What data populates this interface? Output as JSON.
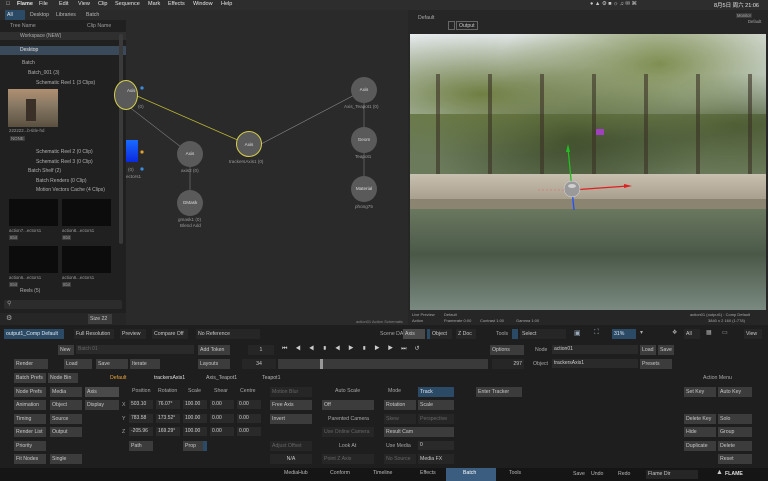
{
  "menubar": {
    "app": "Flame",
    "items": [
      "File",
      "Edit",
      "View",
      "Clip",
      "Sequence",
      "Mark",
      "Effects",
      "Window",
      "Help"
    ],
    "clock": "8月5日 周六 21:06"
  },
  "library": {
    "tabs": [
      "All",
      "Desktop",
      "Libraries",
      "Batch"
    ],
    "col_tree": "Tree Name",
    "col_clip": "Clip Name",
    "workspace": "Workspace (NEW)",
    "desktop": "Desktop",
    "batch": "Batch",
    "batch_001": "Batch_001 (3)",
    "schem1": "Schematic Reel 1 (3 Clips)",
    "clip_name": "222222...b-title-hd",
    "clip_badge": "NONE",
    "schem2": "Schematic Reel 2 (0 Clip)",
    "schem3": "Schematic Reel 3 (0 Clip)",
    "shelf": "Batch Shelf (2)",
    "renders": "Batch Renders (0 Clip)",
    "motion": "Motion Vectors Cache (4 Clips)",
    "thumbs": [
      {
        "name": "action7...ectors1",
        "badge": "8bit"
      },
      {
        "name": "action8...ectors1",
        "badge": "8bit"
      },
      {
        "name": "action6...ectors1",
        "badge": "8bit"
      },
      {
        "name": "action6...ectors1",
        "badge": "8bit"
      }
    ],
    "reels": "Reels (5)",
    "size": "Size 22"
  },
  "schematic": {
    "nodes": [
      {
        "name": "Axis",
        "label": "Axis_Teapot1 (0)"
      },
      {
        "name": "Geom",
        "label": "Teapot1"
      },
      {
        "name": "Material",
        "label": "phong75"
      },
      {
        "name": "Axis",
        "label": "trackersAxis1 (0)"
      },
      {
        "name": "Axis",
        "label": "axis2 (0)"
      },
      {
        "name": "GMask",
        "label": "gmask1 (0)"
      },
      {
        "name": "Axis",
        "label": "axis1 (0)"
      }
    ],
    "gmask_sub": "Blend Add",
    "partial_a": "(0)",
    "partial_b": "ectors1",
    "footer": "action01 Action Schematic"
  },
  "viewer": {
    "title": "Default",
    "output_btn": "Output",
    "monitor": "Monitor",
    "default_right": "Default",
    "status_l1": [
      "Live Preview",
      "Default"
    ],
    "status_l2": [
      "Action",
      "Framerate 0:00",
      "Contrast 1:00",
      "Gamma 1:00"
    ],
    "status_r1": "action01 (output1) : Comp Default",
    "status_r2": "3840 x 2 160 (1:778)"
  },
  "controls": {
    "tab_output": "output1_Comp Default",
    "full_res": "Full Resolution",
    "preview": "Preview",
    "compare_off": "Compare Off",
    "no_reference": "No Reference",
    "scene": "Scene DA",
    "axis_sel": "Axis",
    "object": "Object",
    "zdoc": "Z Doc",
    "tools": "Tools",
    "select": "Select",
    "zoom": "31%",
    "all": "All",
    "view": "View",
    "new": "New",
    "batch01": "Batch 01",
    "add_token": "Add Token",
    "frame": "1",
    "options": "Options",
    "node_lbl": "Node",
    "node_val": "action01",
    "load": "Load",
    "save": "Save",
    "render": "Render",
    "load2": "Load",
    "save2": "Save",
    "iterate": "Iterate",
    "layouts": "Layouts",
    "frame34": "34",
    "frame297": "297",
    "object_lbl": "Object",
    "object_val": "trackersAxis1",
    "presets": "Presets",
    "batch_prefs": "Batch Prefs",
    "node_bin": "Node Bin",
    "tabs": [
      "Default",
      "trackersAxis1",
      "Axis_Teapot1",
      "Teapot1"
    ],
    "action_menu": "Action Menu",
    "node_prefs": "Node Prefs",
    "media": "Media",
    "axis_btn": "Axis",
    "animation": "Animation",
    "object2": "Object",
    "display": "Display",
    "timing": "Timing",
    "source": "Source",
    "render_list": "Render List",
    "output2": "Output",
    "priority": "Priority",
    "fit_nodes": "Fit Nodes",
    "single": "Single",
    "col_headers": [
      "Position",
      "Rotation",
      "Scale",
      "Shear",
      "Centre"
    ],
    "rows": [
      {
        "axis": "X",
        "pos": "503.10",
        "rot": "76.07°",
        "scale": "100.00",
        "shear": "0.00",
        "centre": "0.00"
      },
      {
        "axis": "Y",
        "pos": "783.58",
        "rot": "173.52°",
        "scale": "100.00",
        "shear": "0.00",
        "centre": "0.00"
      },
      {
        "axis": "Z",
        "pos": "-205.96",
        "rot": "169.29°",
        "scale": "100.00",
        "shear": "0.00",
        "centre": "0.00"
      }
    ],
    "path": "Path",
    "prop": "Prop",
    "motion_blur": "Motion Blur",
    "free_axis": "Free Axis",
    "invert": "Invert",
    "adjust_offset": "Adjust Offset",
    "na": "N/A",
    "auto_scale": "Auto Scale",
    "off": "Off",
    "parented_camera": "Parented Camera",
    "use_online_camera": "Use Online Camera",
    "look_at": "Look At",
    "point_z_axis": "Point Z Axis",
    "mode": "Mode",
    "track": "Track",
    "rotation2": "Rotation",
    "scale2": "Scale",
    "skew": "Skew",
    "perspective": "Perspective",
    "result_cam": "Result Cam",
    "use_media": "Use Media",
    "media_val": "0",
    "no_source": "No Source",
    "media_fx": "Media FX",
    "enter_tracker": "Enter Tracker",
    "set_key": "Set Key",
    "auto_key": "Auto Key",
    "delete_key": "Delete Key",
    "solo": "Solo",
    "hide": "Hide",
    "group": "Group",
    "duplicate": "Duplicate",
    "delete": "Delete",
    "reset": "Reset"
  },
  "bottombar": {
    "tabs": [
      "MediaHub",
      "Conform",
      "Timeline",
      "Effects",
      "Batch",
      "Tools"
    ],
    "active": "Batch",
    "save": "Save",
    "undo": "Undo",
    "redo": "Redo",
    "flame_dir": "Flame Dir",
    "brand": "FLAME"
  },
  "colors": {
    "accent_blue": "#2b4a66",
    "active_tab": "#e8a43a",
    "selected_node_ring": "#d6d04a",
    "link_yellow": "#b9b533",
    "bottom_active": "#3b5d80"
  }
}
